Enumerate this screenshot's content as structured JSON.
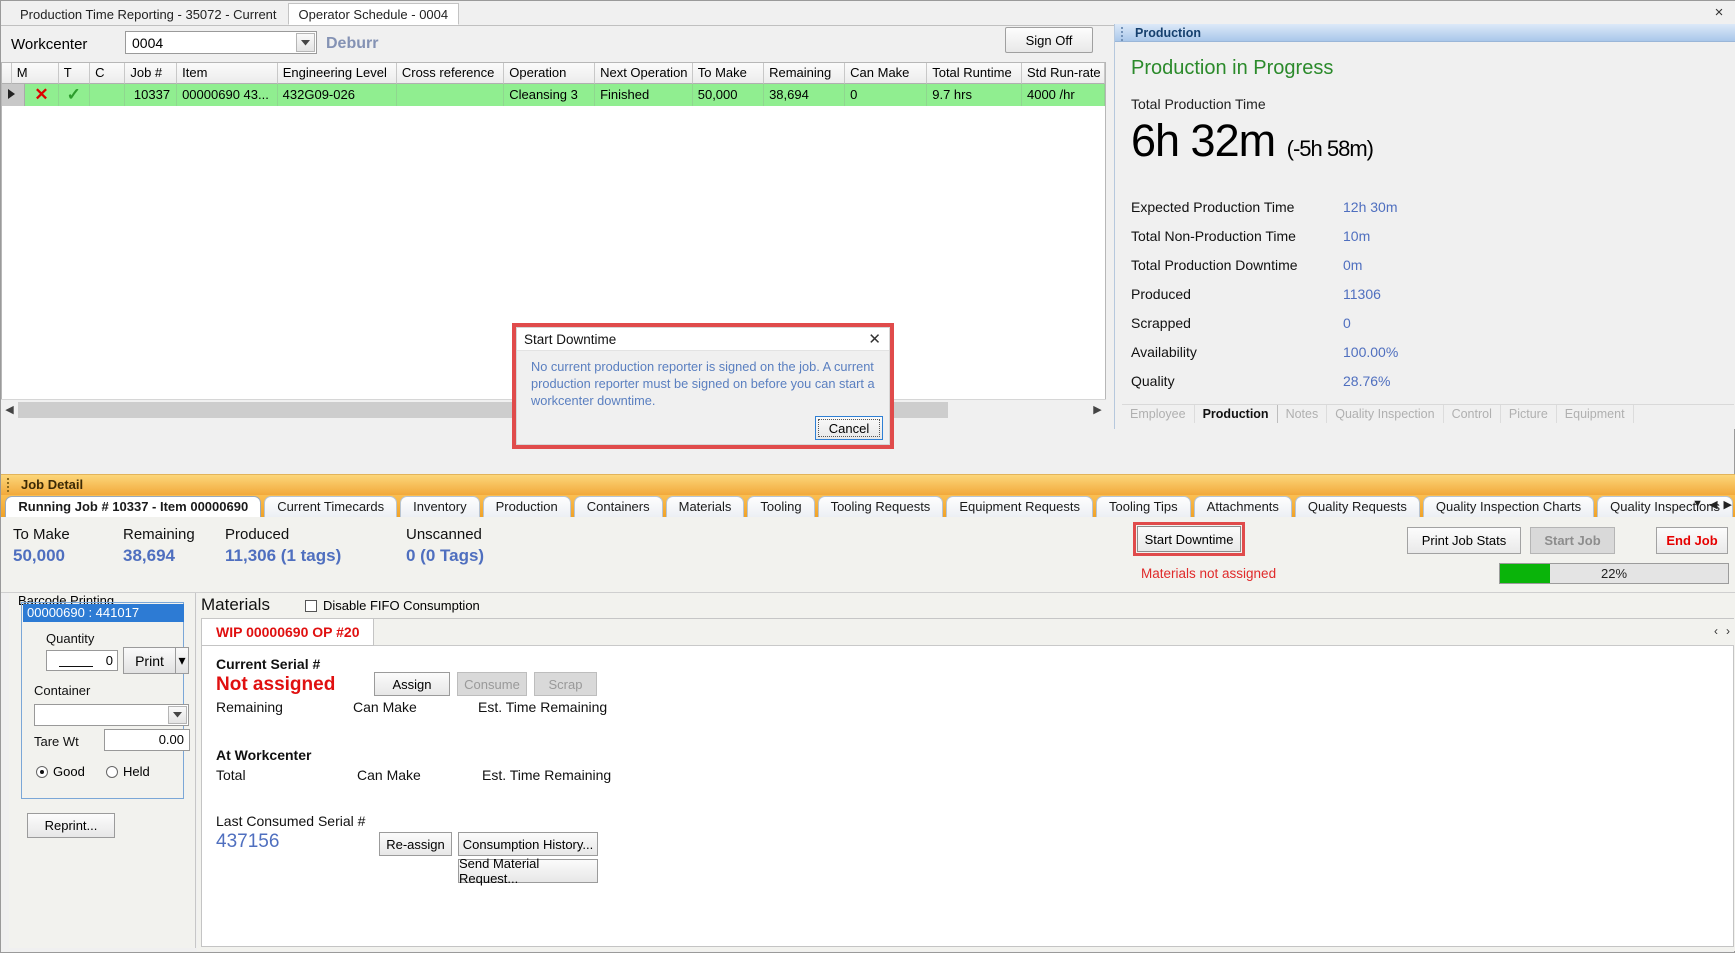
{
  "window": {
    "tabs": [
      {
        "label": "Production Time Reporting - 35072 - Current",
        "active": false
      },
      {
        "label": "Operator Schedule - 0004",
        "active": true
      }
    ],
    "close_icon": "×"
  },
  "workcenter": {
    "label": "Workcenter",
    "value": "0004",
    "name": "Deburr",
    "sign_off_label": "Sign Off"
  },
  "grid": {
    "columns": [
      "M",
      "T",
      "C",
      "Job #",
      "Item",
      "Engineering Level",
      "Cross reference",
      "Operation",
      "Next Operation",
      "To Make",
      "Remaining",
      "Can Make",
      "Total Runtime",
      "Std Run-rate"
    ],
    "rows": [
      {
        "m": "✕",
        "t": "✓",
        "c": "",
        "job": "10337",
        "item": "00000690  43...",
        "engineering_level": "432G09-026",
        "cross_reference": "",
        "operation": "Cleansing 3",
        "next_operation": "Finished",
        "to_make": "50,000",
        "remaining": "38,694",
        "can_make": "0",
        "total_runtime": "9.7 hrs",
        "std_run_rate": "4000 /hr"
      }
    ]
  },
  "production_panel": {
    "title": "Production",
    "heading": "Production in Progress",
    "total_production_time_label": "Total Production Time",
    "total_production_time": "6h 32m",
    "total_production_delta": "(-5h 58m)",
    "stats": [
      {
        "label": "Expected Production Time",
        "value": "12h 30m"
      },
      {
        "label": "Total Non-Production Time",
        "value": "10m"
      },
      {
        "label": "Total Production Downtime",
        "value": "0m"
      },
      {
        "label": "Produced",
        "value": "11306"
      },
      {
        "label": "Scrapped",
        "value": "0"
      },
      {
        "label": "Availability",
        "value": "100.00%"
      },
      {
        "label": "Quality",
        "value": "28.76%"
      }
    ],
    "tabs": [
      {
        "label": "Employee",
        "selected": false
      },
      {
        "label": "Production",
        "selected": true
      },
      {
        "label": "Notes",
        "selected": false
      },
      {
        "label": "Quality Inspection",
        "selected": false
      },
      {
        "label": "Control",
        "selected": false
      },
      {
        "label": "Picture",
        "selected": false
      },
      {
        "label": "Equipment",
        "selected": false
      }
    ]
  },
  "job_detail": {
    "band_title": "Job Detail",
    "tabs": [
      {
        "label": "Running Job # 10337 - Item 00000690",
        "active": true
      },
      {
        "label": "Current Timecards",
        "active": false
      },
      {
        "label": "Inventory",
        "active": false
      },
      {
        "label": "Production",
        "active": false
      },
      {
        "label": "Containers",
        "active": false
      },
      {
        "label": "Materials",
        "active": false
      },
      {
        "label": "Tooling",
        "active": false
      },
      {
        "label": "Tooling Requests",
        "active": false
      },
      {
        "label": "Equipment Requests",
        "active": false
      },
      {
        "label": "Tooling Tips",
        "active": false
      },
      {
        "label": "Attachments",
        "active": false
      },
      {
        "label": "Quality Requests",
        "active": false
      },
      {
        "label": "Quality Inspection Charts",
        "active": false
      },
      {
        "label": "Quality Inspections",
        "active": false
      }
    ],
    "nav_prev_icon": "▼",
    "nav_left_icon": "◀",
    "nav_right_icon": "▶"
  },
  "stats_strip": {
    "to_make_label": "To Make",
    "to_make_value": "50,000",
    "remaining_label": "Remaining",
    "remaining_value": "38,694",
    "produced_label": "Produced",
    "produced_value": "11,306 (1 tags)",
    "unscanned_label": "Unscanned",
    "unscanned_value": "0 (0 Tags)",
    "start_downtime_label": "Start Downtime",
    "materials_warning": "Materials not assigned",
    "print_job_stats_label": "Print Job Stats",
    "start_job_label": "Start Job",
    "end_job_label": "End Job",
    "progress_text": "22%",
    "progress_percent": 22
  },
  "barcode_printing": {
    "legend": "Barcode Printing",
    "selected_item": "00000690 : 441017",
    "quantity_label": "Quantity",
    "quantity_value": "0",
    "print_label": "Print",
    "print_dropdown_icon": "▾",
    "container_label": "Container",
    "container_value": "",
    "tare_wt_label": "Tare Wt",
    "tare_wt_value": "0.00",
    "good_label": "Good",
    "held_label": "Held",
    "reprint_label": "Reprint..."
  },
  "materials": {
    "title": "Materials",
    "disable_fifo_label": "Disable FIFO Consumption",
    "tab_label": "WIP 00000690 OP #20",
    "current_serial_label": "Current Serial #",
    "current_serial_value": "Not assigned",
    "assign_label": "Assign",
    "consume_label": "Consume",
    "scrap_label": "Scrap",
    "remaining_label": "Remaining",
    "can_make_label": "Can Make",
    "est_time_remaining_label": "Est. Time Remaining",
    "at_workcenter_label": "At Workcenter",
    "total_label": "Total",
    "wc_can_make_label": "Can Make",
    "wc_est_time_remaining_label": "Est. Time Remaining",
    "last_consumed_label": "Last Consumed Serial #",
    "last_consumed_value": "437156",
    "reassign_label": "Re-assign",
    "consumption_history_label": "Consumption History...",
    "send_material_request_label": "Send Material Request...",
    "nav_left_icon": "‹",
    "nav_right_icon": "›"
  },
  "modal": {
    "title": "Start Downtime",
    "close_icon": "✕",
    "message": "No current production reporter is signed on the job. A current production reporter must be signed on before you can start a workcenter downtime.",
    "cancel_label": "Cancel"
  },
  "colors": {
    "accent_red": "#e04b4b",
    "row_green": "#90ee90",
    "value_blue": "#4f6fbf",
    "progress_green": "#0ab40a"
  }
}
